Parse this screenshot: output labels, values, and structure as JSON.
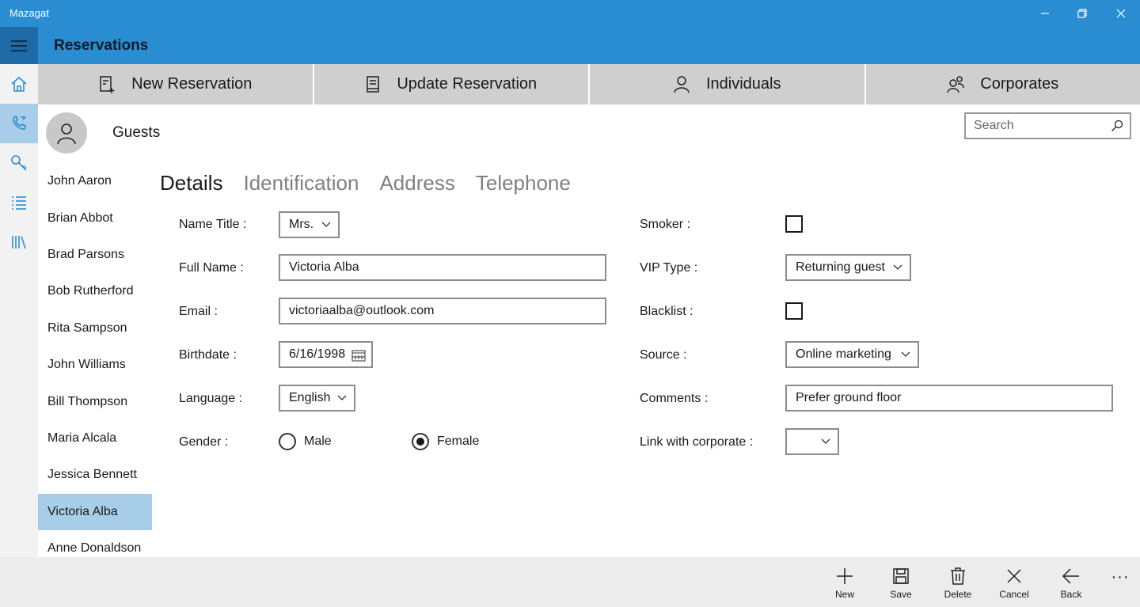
{
  "window": {
    "title": "Mazagat"
  },
  "header": {
    "title": "Reservations"
  },
  "command_tabs": [
    {
      "label": "New Reservation",
      "icon": "new-reservation-icon"
    },
    {
      "label": "Update Reservation",
      "icon": "update-reservation-icon"
    },
    {
      "label": "Individuals",
      "icon": "person-icon"
    },
    {
      "label": "Corporates",
      "icon": "people-icon"
    }
  ],
  "guests": {
    "heading": "Guests",
    "search_placeholder": "Search",
    "list": [
      "John Aaron",
      "Brian Abbot",
      "Brad Parsons",
      "Bob Rutherford",
      "Rita Sampson",
      "John Williams",
      "Bill Thompson",
      "Maria Alcala",
      "Jessica Bennett",
      "Victoria Alba",
      "Anne Donaldson"
    ],
    "selected": "Victoria Alba"
  },
  "detail_tabs": [
    "Details",
    "Identification",
    "Address",
    "Telephone"
  ],
  "form": {
    "name_title": {
      "label": "Name Title :",
      "value": "Mrs."
    },
    "full_name": {
      "label": "Full Name :",
      "value": "Victoria Alba"
    },
    "email": {
      "label": "Email :",
      "value": "victoriaalba@outlook.com"
    },
    "birthdate": {
      "label": "Birthdate :",
      "value": "6/16/1998"
    },
    "language": {
      "label": "Language :",
      "value": "English"
    },
    "gender": {
      "label": "Gender :",
      "options": [
        "Male",
        "Female"
      ],
      "selected": "Female"
    },
    "smoker": {
      "label": "Smoker :",
      "checked": false
    },
    "vip_type": {
      "label": "VIP Type :",
      "value": "Returning guest"
    },
    "blacklist": {
      "label": "Blacklist :",
      "checked": false
    },
    "source": {
      "label": "Source :",
      "value": "Online marketing"
    },
    "comments": {
      "label": "Comments :",
      "value": "Prefer ground floor"
    },
    "link_corporate": {
      "label": "Link with corporate :",
      "value": ""
    }
  },
  "app_bar": {
    "new": "New",
    "save": "Save",
    "delete": "Delete",
    "cancel": "Cancel",
    "back": "Back",
    "more": "···"
  }
}
